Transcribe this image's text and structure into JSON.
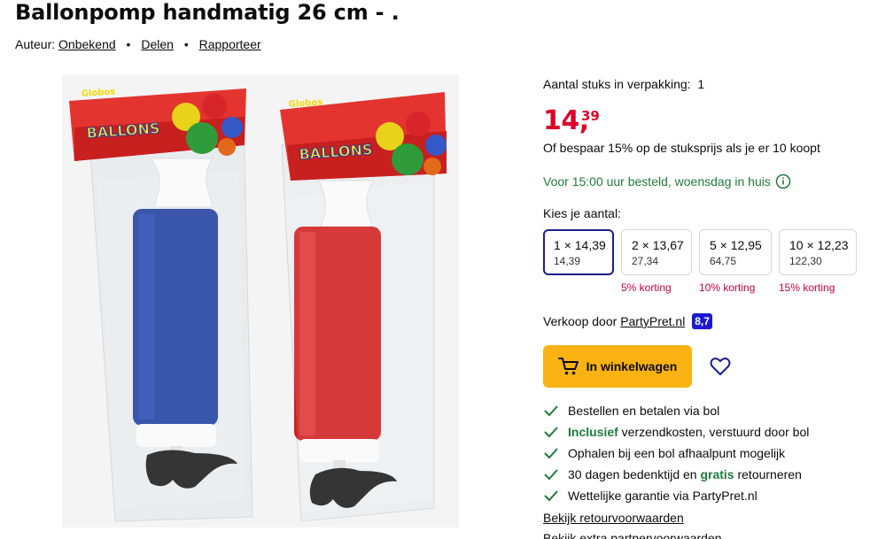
{
  "title": "Ballonpomp handmatig 26 cm - .",
  "meta": {
    "author_label": "Auteur:",
    "author_name": "Onbekend",
    "share": "Delen",
    "report": "Rapporteer",
    "separator": "•"
  },
  "image": {
    "brand_text": "Globos",
    "pack_text": "BALLONS",
    "pump_colors": [
      "#1e3fa0",
      "#d01e1e"
    ]
  },
  "pack_info": {
    "label": "Aantal stuks in verpakking:",
    "value": "1"
  },
  "price": {
    "integer": "14,",
    "decimals": "39",
    "color": "#e00028"
  },
  "bulk_offer": "Of bespaar 15% op de stuksprijs als je er 10 koopt",
  "delivery": "Voor 15:00 uur besteld, woensdag in huis",
  "quantity": {
    "label": "Kies je aantal:",
    "options": [
      {
        "main": "1 × 14,39",
        "total": "14,39",
        "discount": ""
      },
      {
        "main": "2 × 13,67",
        "total": "27,34",
        "discount": "5% korting"
      },
      {
        "main": "5 × 12,95",
        "total": "64,75",
        "discount": "10% korting"
      },
      {
        "main": "10 × 12,23",
        "total": "122,30",
        "discount": "15% korting"
      }
    ],
    "selected_index": 0
  },
  "seller": {
    "label": "Verkoop door",
    "name": "PartyPret.nl",
    "score": "8,7"
  },
  "cart_button": "In winkelwagen",
  "usps": [
    {
      "pre": "Bestellen en betalen via bol",
      "bold": "",
      "post": ""
    },
    {
      "pre": "",
      "bold": "Inclusief",
      "post": " verzendkosten, verstuurd door bol"
    },
    {
      "pre": "Ophalen bij een bol afhaalpunt mogelijk",
      "bold": "",
      "post": ""
    },
    {
      "pre": "30 dagen bedenktijd en ",
      "bold": "gratis",
      "post": " retourneren"
    },
    {
      "pre": "Wettelijke garantie via PartyPret.nl",
      "bold": "",
      "post": ""
    }
  ],
  "links": {
    "returns": "Bekijk retourvoorwaarden",
    "partner": "Bekijk extra partnervoorwaarden"
  },
  "colors": {
    "accent_blue": "#1c1e8c",
    "cart_yellow": "#fbb314",
    "green": "#1f7a3a",
    "discount_red": "#c5003e"
  }
}
